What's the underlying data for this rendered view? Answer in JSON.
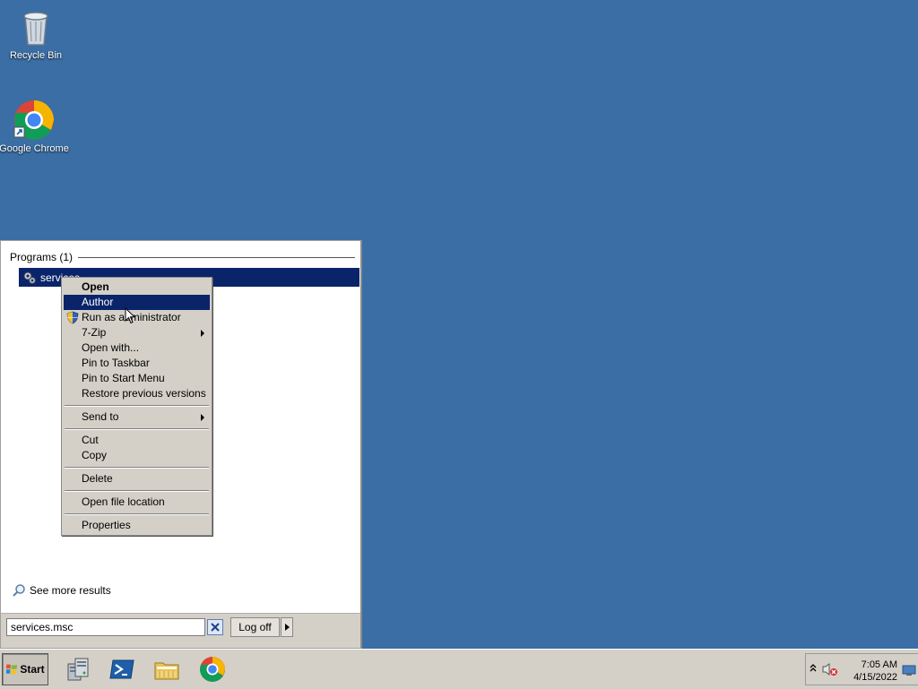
{
  "desktop": {
    "background_color": "#3a6ea5",
    "icons": [
      {
        "label": "Recycle Bin",
        "icon": "recycle-bin-icon"
      },
      {
        "label": "Google Chrome",
        "icon": "chrome-icon"
      }
    ]
  },
  "start_menu": {
    "programs_header": "Programs (1)",
    "result_label": "services",
    "see_more": "See more results",
    "search_value": "services.msc",
    "logoff_label": "Log off"
  },
  "context_menu": {
    "items": [
      {
        "label": "Open",
        "bold": true
      },
      {
        "label": "Author",
        "highlighted": true
      },
      {
        "label": "Run as administrator",
        "icon": "uac-shield-icon"
      },
      {
        "label": "7-Zip",
        "submenu": true
      },
      {
        "label": "Open with..."
      },
      {
        "label": "Pin to Taskbar"
      },
      {
        "label": "Pin to Start Menu"
      },
      {
        "label": "Restore previous versions"
      },
      {
        "label": "Send to",
        "submenu": true
      },
      {
        "label": "Cut"
      },
      {
        "label": "Copy"
      },
      {
        "label": "Delete"
      },
      {
        "label": "Open file location"
      },
      {
        "label": "Properties"
      }
    ]
  },
  "taskbar": {
    "start_label": "Start",
    "pinned": [
      "server-manager-icon",
      "powershell-icon",
      "file-explorer-icon",
      "chrome-icon"
    ],
    "clock_time": "7:05 AM",
    "clock_date": "4/15/2022"
  },
  "colors": {
    "selection": "#0a246a",
    "menu_background": "#d4d0c8"
  }
}
